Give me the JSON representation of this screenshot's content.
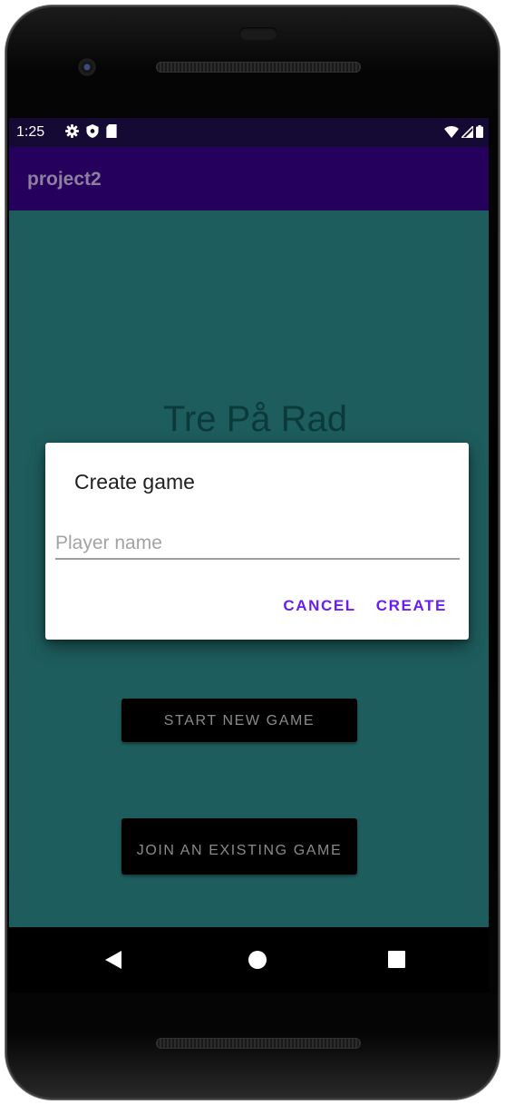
{
  "status_bar": {
    "time": "1:25",
    "left_icons": [
      "gear-icon",
      "shield-icon",
      "sd-card-icon"
    ],
    "right_icons": [
      "wifi-icon",
      "signal-icon",
      "battery-icon"
    ]
  },
  "app_bar": {
    "title": "project2"
  },
  "main": {
    "title": "Tre På Rad",
    "start_button_label": "START NEW GAME",
    "join_button_label": "JOIN AN EXISTING GAME"
  },
  "dialog": {
    "title": "Create game",
    "input_placeholder": "Player name",
    "input_value": "",
    "cancel_label": "CANCEL",
    "create_label": "CREATE"
  },
  "nav_bar": {
    "icons": [
      "back-icon",
      "home-icon",
      "recents-icon"
    ]
  },
  "colors": {
    "status_bar": "#140a33",
    "app_bar": "#25005c",
    "background": "#1e5d5d",
    "dialog_accent": "#6a1cf2"
  }
}
